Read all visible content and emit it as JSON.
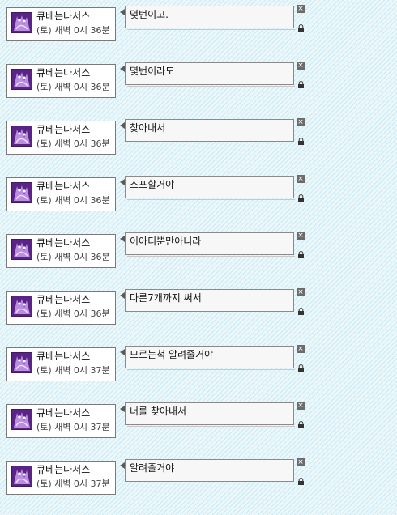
{
  "entries": [
    {
      "user": "큐베는나서스",
      "time": "(토) 새벽 0시 36분",
      "message": "몇번이고."
    },
    {
      "user": "큐베는나서스",
      "time": "(토) 새벽 0시 36분",
      "message": "몇번이라도"
    },
    {
      "user": "큐베는나서스",
      "time": "(토) 새벽 0시 36분",
      "message": "찾아내서"
    },
    {
      "user": "큐베는나서스",
      "time": "(토) 새벽 0시 36분",
      "message": "스포할거야"
    },
    {
      "user": "큐베는나서스",
      "time": "(토) 새벽 0시 36분",
      "message": "이아디뿐만아니라"
    },
    {
      "user": "큐베는나서스",
      "time": "(토) 새벽 0시 36분",
      "message": "다른7개까지 써서"
    },
    {
      "user": "큐베는나서스",
      "time": "(토) 새벽 0시 37분",
      "message": "모르는척 알려줄거야"
    },
    {
      "user": "큐베는나서스",
      "time": "(토) 새벽 0시 37분",
      "message": "너를 찾아내서"
    },
    {
      "user": "큐베는나서스",
      "time": "(토) 새벽 0시 37분",
      "message": "알려줄거야"
    }
  ],
  "icons": {
    "close": "close-icon",
    "lock": "lock-icon",
    "avatar": "avatar"
  },
  "colors": {
    "avatar_bg": "#6b2e9a",
    "background": "#dff2f8"
  }
}
